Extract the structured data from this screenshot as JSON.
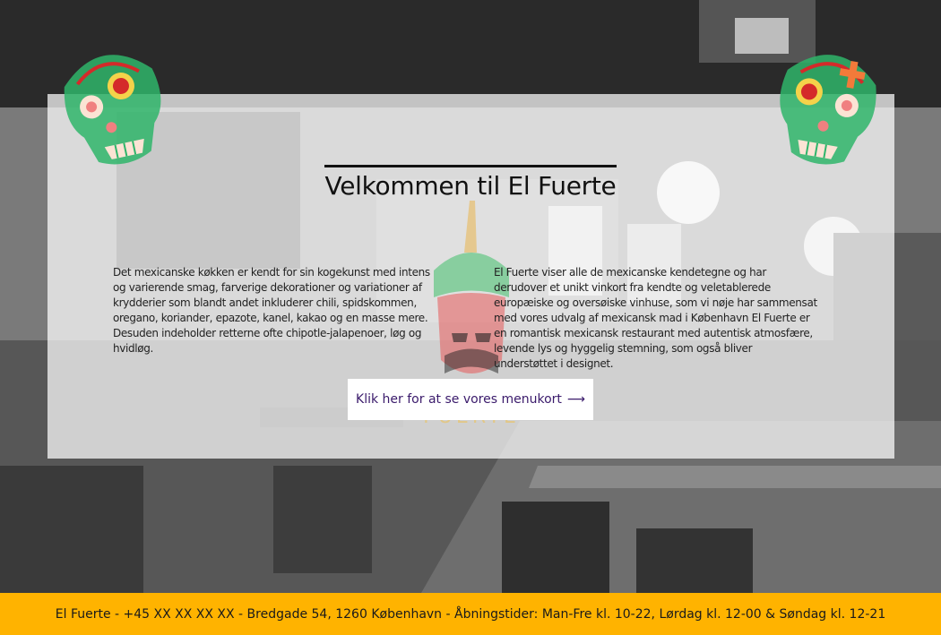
{
  "page": {
    "heading": "Velkommen til El Fuerte",
    "paragraph_left": "Det mexicanske køkken er kendt for sin kogekunst med intens og varierende smag, farverige dekorationer og variationer af krydderier som blandt andet inkluderer chili, spidskommen, oregano, koriander, epazote, kanel, kakao og en masse mere. Desuden indeholder retterne ofte chipotle-jalapenoer, løg og hvidløg.",
    "paragraph_right": "El Fuerte viser alle de mexicanske kendetegne og har derudover et unikt vinkort fra kendte og veletablerede europæiske og oversøiske vinhuse, som vi nøje har sammensat med vores udvalg af mexicansk mad i København El Fuerte er en romantisk mexicansk restaurant med autentisk atmosfære, levende lys og hyggelig stemning, som også bliver understøttet i designet.",
    "menu_button_label": "Klik her for at se vores menukort",
    "menu_button_arrow": "⟶",
    "logo_text": "FUERTE"
  },
  "footer": {
    "text": "El Fuerte - +45 XX XX XX XX - Bredgade 54, 1260 København - Åbningstider: Man-Fre kl. 10-22, Lørdag kl. 12-00 & Søndag kl. 12-21"
  },
  "colors": {
    "footer_bg": "#ffb300",
    "button_text": "#3a1a6b",
    "skull_green": "#2fb56a",
    "skull_red": "#d42a2a"
  },
  "icons": {
    "left_skull": "sugar-skull-icon",
    "right_skull": "sugar-skull-icon",
    "logo": "chili-pepper-logo"
  }
}
